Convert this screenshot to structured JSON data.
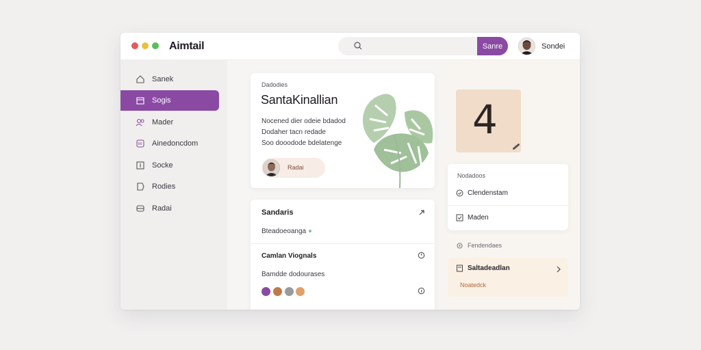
{
  "window": {
    "traffic_lights": [
      "#e25a5a",
      "#e8c23f",
      "#5bbd5e"
    ],
    "app_title": "Aimtail"
  },
  "header": {
    "search_icon": "search-icon",
    "search_button_label": "Sanre",
    "user_name": "Sondei"
  },
  "sidebar": {
    "items": [
      {
        "label": "Sanek",
        "icon": "home-icon",
        "active": false
      },
      {
        "label": "Sogis",
        "icon": "calendar-icon",
        "active": true
      },
      {
        "label": "Mader",
        "icon": "people-icon",
        "active": false
      },
      {
        "label": "Ainedoncdom",
        "icon": "image-icon",
        "active": false
      },
      {
        "label": "Socke",
        "icon": "doc-icon",
        "active": false
      },
      {
        "label": "Rodies",
        "icon": "tag-icon",
        "active": false
      },
      {
        "label": "Radai",
        "icon": "mail-icon",
        "active": false
      }
    ]
  },
  "hero": {
    "eyebrow": "Dadodies",
    "title": "SantaKinallian",
    "desc_lines": [
      "Nocened dier odeie bdadod",
      "Dodaher tacn redade",
      "Soo dooodode bdelatenge"
    ],
    "pill_label": "Radai"
  },
  "panel": {
    "section1_title": "Sandaris",
    "section1_sub": "Bteadoeoanga",
    "section2_title": "Camlan Viognals",
    "section2_sub": "Bamdde dodourases"
  },
  "right": {
    "tile_char": "4",
    "list_header": "Nodadoos",
    "list_items": [
      "Clendenstam",
      "Maden"
    ],
    "section_label": "Fendendaes",
    "card_title": "Saltadeadlan",
    "card_sub": "Noatedck"
  },
  "colors": {
    "accent": "#8a4aa3",
    "accent_light": "#f7ece6",
    "leaf": "#a9c8a2"
  }
}
